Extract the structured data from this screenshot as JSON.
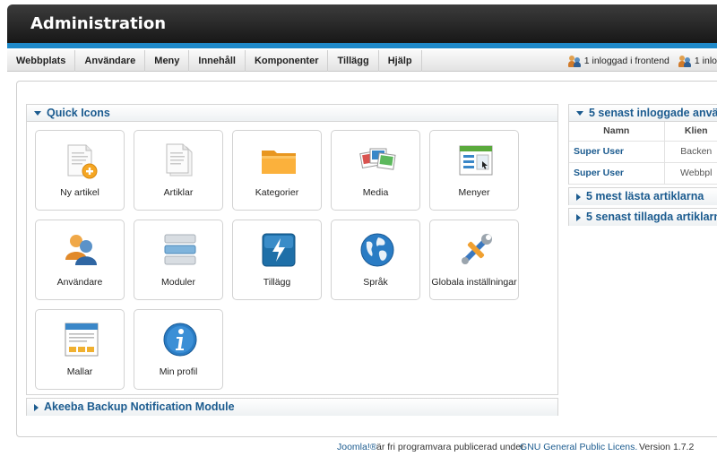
{
  "header": {
    "title": "Administration"
  },
  "menu": {
    "items": [
      {
        "label": "Webbplats",
        "name": "menu-webbplats"
      },
      {
        "label": "Användare",
        "name": "menu-anvandare"
      },
      {
        "label": "Meny",
        "name": "menu-meny"
      },
      {
        "label": "Innehåll",
        "name": "menu-innehall"
      },
      {
        "label": "Komponenter",
        "name": "menu-komponenter"
      },
      {
        "label": "Tillägg",
        "name": "menu-tillagg"
      },
      {
        "label": "Hjälp",
        "name": "menu-hjalp"
      }
    ]
  },
  "status": {
    "frontend": "1 inloggad i frontend",
    "backend": "1 inlo"
  },
  "quick_icons": {
    "title": "Quick Icons",
    "items": [
      {
        "label": "Ny artikel",
        "icon": "new-article-icon"
      },
      {
        "label": "Artiklar",
        "icon": "articles-icon"
      },
      {
        "label": "Kategorier",
        "icon": "folder-icon"
      },
      {
        "label": "Media",
        "icon": "media-icon"
      },
      {
        "label": "Menyer",
        "icon": "menus-icon"
      },
      {
        "label": "Användare",
        "icon": "users-icon"
      },
      {
        "label": "Moduler",
        "icon": "modules-icon"
      },
      {
        "label": "Tillägg",
        "icon": "extensions-icon"
      },
      {
        "label": "Språk",
        "icon": "globe-icon"
      },
      {
        "label": "Globala inställningar",
        "icon": "tools-icon"
      },
      {
        "label": "Mallar",
        "icon": "templates-icon"
      },
      {
        "label": "Min profil",
        "icon": "info-icon"
      }
    ]
  },
  "akeeba": {
    "title": "Akeeba Backup Notification Module"
  },
  "logged_users": {
    "title": "5 senast inloggade anvä",
    "columns": [
      "Namn",
      "Klient"
    ],
    "col_name": "Namn",
    "col_client": "Klien",
    "rows": [
      {
        "name": "Super User",
        "client": "Backen"
      },
      {
        "name": "Super User",
        "client": "Webbpl"
      }
    ]
  },
  "popular": {
    "title": "5 mest lästa artiklarna"
  },
  "latest": {
    "title": "5 senast tillagda artiklarn"
  },
  "footer": {
    "joomla": "Joomla!®",
    "text": "är fri programvara publicerad under",
    "license": "GNU General Public Licens.",
    "version": "Version 1.7.2"
  },
  "colors": {
    "accent": "#1b5b8f",
    "header_bar": "#1e89c9"
  }
}
